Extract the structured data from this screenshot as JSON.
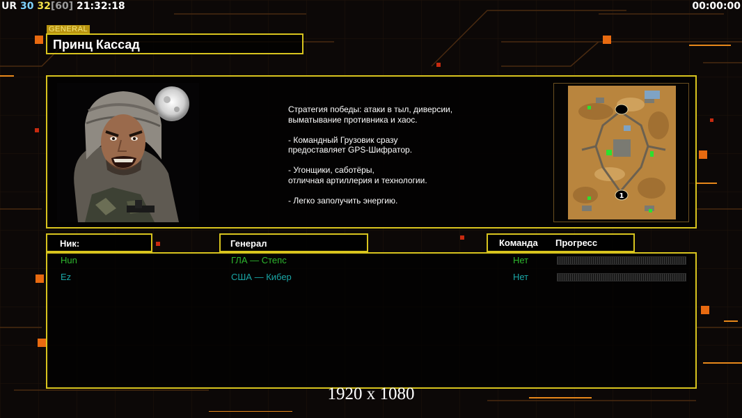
{
  "hud": {
    "ur": "UR",
    "val30": "30",
    "val32": "32",
    "val60": "[60]",
    "clock": "21:32:18",
    "timer": "00:00:00"
  },
  "header": {
    "tag": "GENERAL",
    "title": "Принц Кассад"
  },
  "strategy": [
    "Стратегия победы: атаки в тыл, диверсии,\n выматывание противника и хаос.",
    "- Командный Грузовик сразу\nпредоставляет GPS-Шифратор.",
    "- Угонщики, саботёры,\nотличная артиллерия и технологии.",
    "- Легко заполучить энергию."
  ],
  "minimap": {
    "markers": [
      "1"
    ]
  },
  "table": {
    "col_nick": "Ник:",
    "col_general": "Генерал",
    "col_team": "Команда",
    "col_progress": "Прогресс",
    "rows": [
      {
        "nick": "Hun",
        "general": "ГЛА — Степс",
        "team": "Нет",
        "progress": 0
      },
      {
        "nick": "Ez",
        "general": "США — Кибер",
        "team": "Нет",
        "progress": 0
      }
    ]
  },
  "colors": {
    "accent": "#d8c41e",
    "player1": "#2eb82e",
    "player2": "#1aa6a6"
  },
  "footer": {
    "resolution": "1920 x 1080"
  }
}
